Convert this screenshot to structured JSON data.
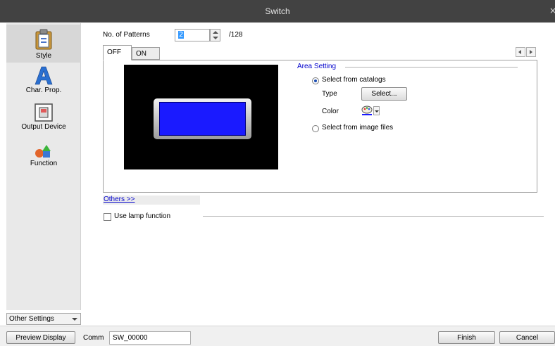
{
  "window": {
    "title": "Switch",
    "close_glyph": "×"
  },
  "sidebar": {
    "items": [
      {
        "label": "Style",
        "icon": "clipboard-icon",
        "active": true
      },
      {
        "label": "Char. Prop.",
        "icon": "letter-a-icon"
      },
      {
        "label": "Output Device",
        "icon": "output-device-icon"
      },
      {
        "label": "Function",
        "icon": "shapes-icon"
      }
    ],
    "other_settings": "Other Settings"
  },
  "patterns": {
    "label": "No. of Patterns",
    "value": "2",
    "max": "/128"
  },
  "tabs": [
    {
      "label": "OFF",
      "selected": true
    },
    {
      "label": "ON",
      "selected": false
    }
  ],
  "area_setting": {
    "title": "Area Setting",
    "select_from_catalogs": "Select from catalogs",
    "type_label": "Type",
    "select_button": "Select...",
    "color_label": "Color",
    "select_from_image_files": "Select from image files",
    "selected_option": "Select from catalogs"
  },
  "preview": {
    "background": "#000000",
    "switch_color": "#1a1aff"
  },
  "others_link": "Others >>",
  "lamp": {
    "label": "Use lamp function",
    "checked": false
  },
  "footer": {
    "preview_button": "Preview Display",
    "comm_label": "Comm",
    "comm_value": "SW_00000",
    "finish_button": "Finish",
    "cancel_button": "Cancel"
  }
}
